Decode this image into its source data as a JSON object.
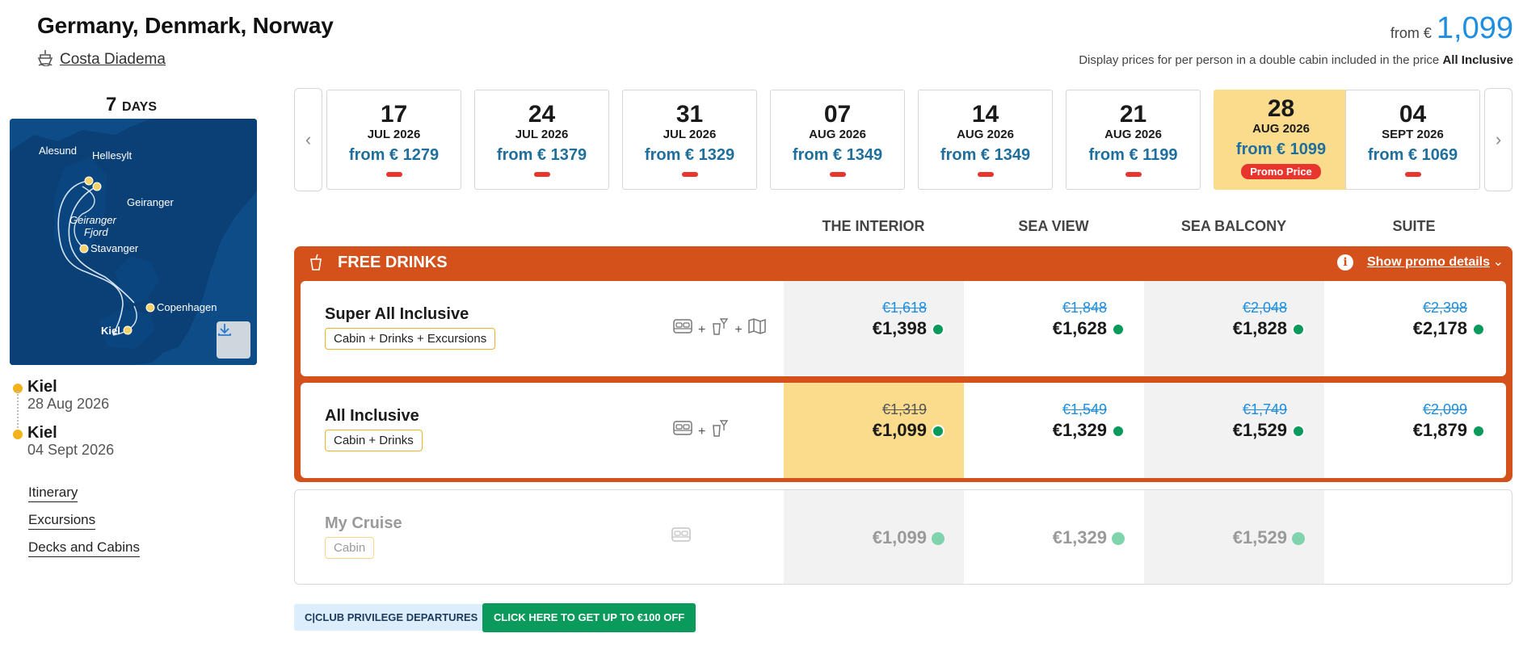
{
  "header": {
    "title": "Germany, Denmark, Norway",
    "ship": "Costa Diadema",
    "from_label": "from €",
    "from_price": "1,099",
    "display_note": "Display prices for per person in a double cabin included in the price",
    "display_note_bold": "All Inclusive"
  },
  "sidebar": {
    "days_number": "7",
    "days_label": "DAYS",
    "map_labels": [
      "Alesund",
      "Hellesylt",
      "Geiranger",
      "Geiranger",
      "Fjord",
      "Stavanger",
      "Copenhagen",
      "Kiel"
    ],
    "ports": [
      {
        "name": "Kiel",
        "date": "28 Aug 2026"
      },
      {
        "name": "Kiel",
        "date": "04 Sept 2026"
      }
    ],
    "links": [
      "Itinerary",
      "Excursions",
      "Decks and Cabins"
    ]
  },
  "dates": [
    {
      "day": "17",
      "month": "JUL 2026",
      "price": "from € 1279",
      "active": false
    },
    {
      "day": "24",
      "month": "JUL 2026",
      "price": "from € 1379",
      "active": false
    },
    {
      "day": "31",
      "month": "JUL 2026",
      "price": "from € 1329",
      "active": false
    },
    {
      "day": "07",
      "month": "AUG 2026",
      "price": "from € 1349",
      "active": false
    },
    {
      "day": "14",
      "month": "AUG 2026",
      "price": "from € 1349",
      "active": false
    },
    {
      "day": "21",
      "month": "AUG 2026",
      "price": "from € 1199",
      "active": false
    },
    {
      "day": "28",
      "month": "AUG 2026",
      "price": "from € 1099",
      "active": true,
      "badge": "Promo Price"
    },
    {
      "day": "04",
      "month": "SEPT 2026",
      "price": "from € 1069",
      "active": false
    }
  ],
  "columns": [
    "THE INTERIOR",
    "SEA VIEW",
    "SEA BALCONY",
    "SUITE"
  ],
  "promo": {
    "title": "FREE DRINKS",
    "details_link": "Show promo details",
    "rows": [
      {
        "name": "Super All Inclusive",
        "tag": "Cabin + Drinks + Excursions",
        "icons": [
          "bed-icon",
          "drinks-icon",
          "map-icon"
        ],
        "prices": [
          {
            "old": "€1,618",
            "new": "€1,398"
          },
          {
            "old": "€1,848",
            "new": "€1,628"
          },
          {
            "old": "€2,048",
            "new": "€1,828"
          },
          {
            "old": "€2,398",
            "new": "€2,178"
          }
        ]
      },
      {
        "name": "All Inclusive",
        "tag": "Cabin + Drinks",
        "icons": [
          "bed-icon",
          "drinks-icon"
        ],
        "prices": [
          {
            "old": "€1,319",
            "new": "€1,099"
          },
          {
            "old": "€1,549",
            "new": "€1,329"
          },
          {
            "old": "€1,749",
            "new": "€1,529"
          },
          {
            "old": "€2,099",
            "new": "€1,879"
          }
        ]
      }
    ]
  },
  "my_cruise": {
    "name": "My Cruise",
    "tag": "Cabin",
    "prices": [
      "€1,099",
      "€1,329",
      "€1,529"
    ]
  },
  "buttons": {
    "club": "C|CLUB PRIVILEGE DEPARTURES",
    "offer": "CLICK HERE TO GET UP TO €100 OFF"
  },
  "colors": {
    "accent_blue": "#1d8ee0",
    "promo_orange": "#d4511b",
    "highlight_yellow": "#fbdc8c",
    "availability_green": "#0a9a5c",
    "promo_red": "#e8362f"
  }
}
